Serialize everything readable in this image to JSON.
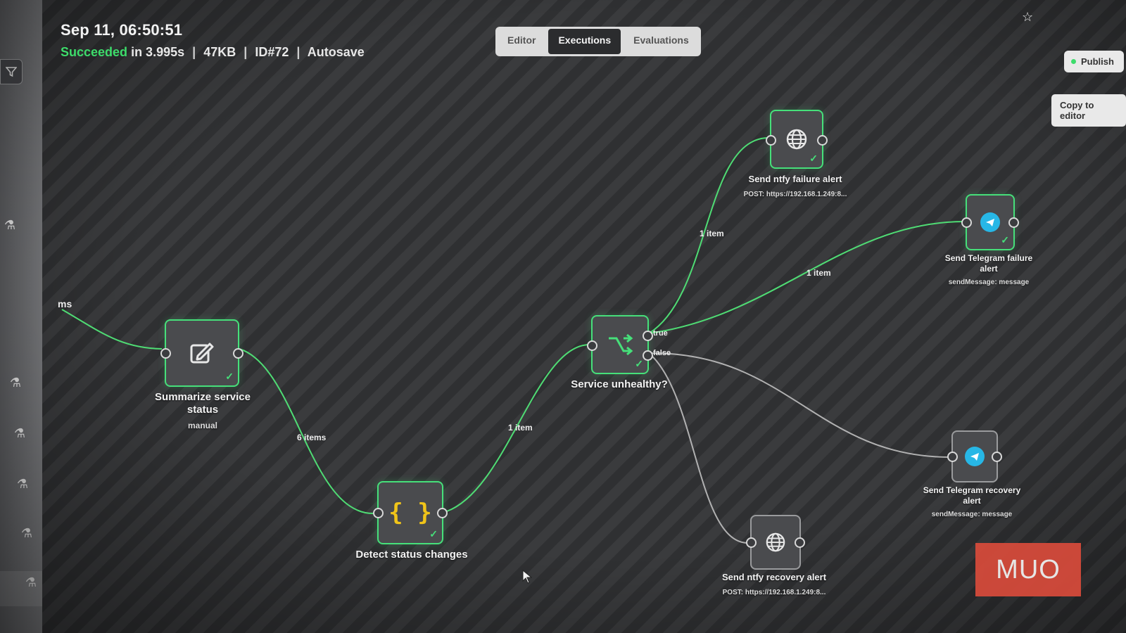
{
  "execution": {
    "time": "Sep 11, 06:50:51",
    "status": "Succeeded",
    "duration": "in 3.995s",
    "size": "47KB",
    "id": "ID#72",
    "save_mode": "Autosave"
  },
  "tabs": [
    {
      "label": "Editor",
      "active": false
    },
    {
      "label": "Executions",
      "active": true
    },
    {
      "label": "Evaluations",
      "active": false
    }
  ],
  "toolbar": {
    "publish_label": "Publish",
    "copy_label": "Copy to editor"
  },
  "partial_edge_label": "ms",
  "nodes": {
    "summarize": {
      "title": "Summarize service status",
      "subtitle": "manual",
      "icon": "edit-icon"
    },
    "detect": {
      "title": "Detect status changes",
      "icon": "code-braces-icon"
    },
    "unhealthy": {
      "title": "Service unhealthy?",
      "icon": "branch-icon",
      "true_label": "true",
      "false_label": "false"
    },
    "ntfy_failure": {
      "title": "Send ntfy failure alert",
      "subtitle": "POST: https://192.168.1.249:8...",
      "icon": "globe-icon"
    },
    "telegram_failure": {
      "title": "Send Telegram failure alert",
      "subtitle": "sendMessage: message",
      "icon": "telegram-icon"
    },
    "telegram_recovery": {
      "title": "Send Telegram recovery alert",
      "subtitle": "sendMessage: message",
      "icon": "telegram-icon"
    },
    "ntfy_recovery": {
      "title": "Send ntfy recovery alert",
      "subtitle": "POST: https://192.168.1.249:8...",
      "icon": "globe-icon"
    }
  },
  "edges": {
    "summarize_to_detect": "6 items",
    "detect_to_unhealthy": "1 item",
    "unhealthy_to_ntfy_failure": "1 item",
    "unhealthy_to_telegram_failure": "1 item"
  },
  "watermark": "MUO",
  "colors": {
    "success": "#46e07a",
    "telegram": "#27b7e6",
    "code": "#f0c419",
    "watermark": "#d94b3b"
  }
}
